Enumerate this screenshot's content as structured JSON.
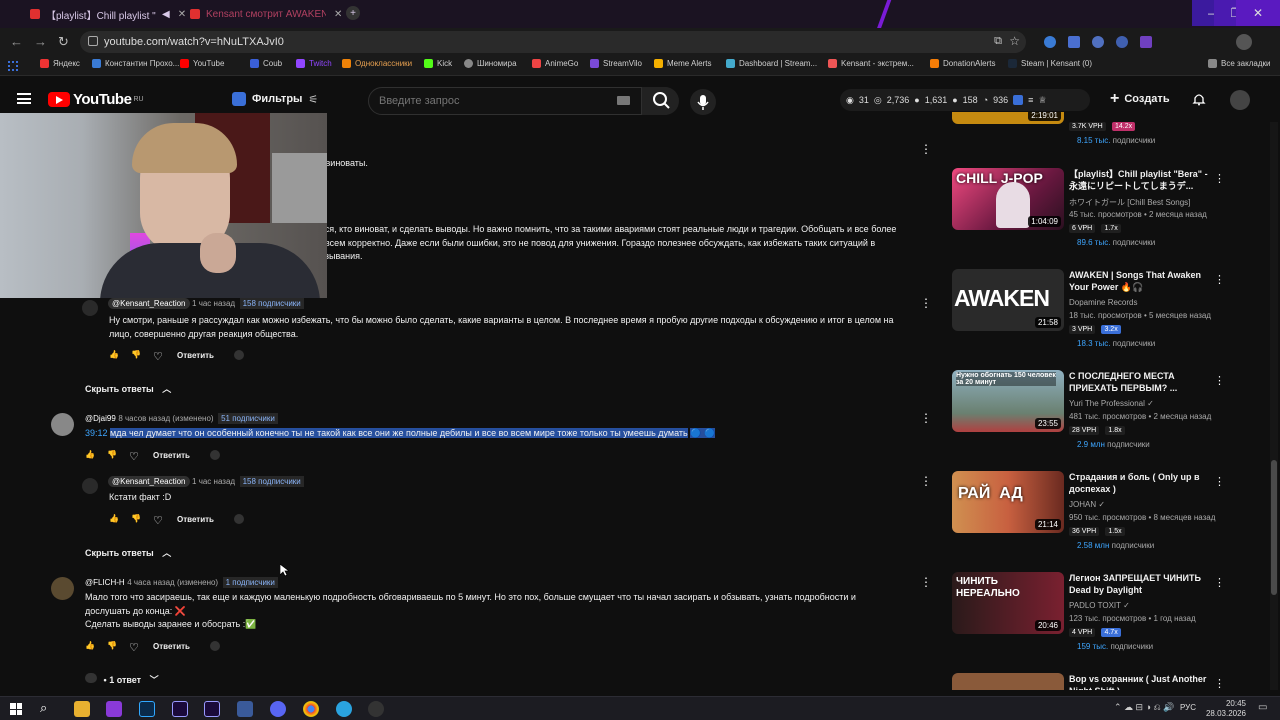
{
  "browser": {
    "tabs": [
      {
        "label": "【playlist】Chill playlist \"Bera\""
      },
      {
        "label": "Kensant смотрит AWAKEN..."
      }
    ],
    "url": "youtube.com/watch?v=hNuLTXAJvI0",
    "bookmarks": [
      "Яндекс",
      "Константин Прохо...",
      "YouTube",
      "Coub",
      "Twitch",
      "Одноклассники",
      "Kick",
      "Шиномира",
      "AnimeGo",
      "StreamVilo",
      "Meme Alerts",
      "Dashboard | Stream...",
      "Kensant - экстрем...",
      "DonationAlerts",
      "Steam | Kensant (0)",
      "Все закладки"
    ]
  },
  "youtube": {
    "logo": "YouTube",
    "region": "RU",
    "filters_label": "Фильтры",
    "search_placeholder": "Введите запрос",
    "stats": [
      "31",
      "2,736",
      "1,631",
      "158",
      "936"
    ],
    "create_label": "Создать"
  },
  "comments": {
    "top_fragment_1": "е виноваты.",
    "top_fragment_2a": "ься, кто виноват, и сделать выводы. Но важно помнить, что за такими авариями стоят реальные люди и трагедии. Обобщать и все более",
    "top_fragment_2b": "овсем корректно. Даже если были ошибки, это не повод для унижения. Гораздо полезнее обсуждать, как избежать таких ситуаций в",
    "top_fragment_2c": "азывания.",
    "reply1": {
      "author": "@Kensant_Reaction",
      "time": "1 час назад",
      "subs": "158 подписчики",
      "text_a": "Ну смотри, раньше я рассуждал как можно избежать, что бы можно было сделать, какие варианты в целом. В последнее время я пробую другие подходы к обсуждению и итог в целом на",
      "text_b": "лицо, совершенно другая реакция общества.",
      "reply_label": "Ответить"
    },
    "hide1": "Скрыть ответы",
    "c2": {
      "author": "@Djai99",
      "time": "8 часов назад (изменено)",
      "subs": "51 подписчики",
      "timestamp": "39:12",
      "text": "мда чел думает что он особенный конечно ты не такой как все они же полные дебилы и все во всем мире тоже только ты умеешь думать",
      "reply_label": "Ответить"
    },
    "reply2": {
      "author": "@Kensant_Reaction",
      "time": "1 час назад",
      "subs": "158 подписчики",
      "text": "Кстати факт :D",
      "reply_label": "Ответить"
    },
    "hide2": "Скрыть ответы",
    "c3": {
      "author": "@FLICH-H",
      "time": "4 часа назад (изменено)",
      "subs": "1 подписчики",
      "text_a": "Мало того что засираешь, так еще и каждую маленькую подробность обговариваешь по 5 минут. Но это пох, больше смущает что ты начал засирать и обзывать, узнать подробности и",
      "text_b": "дослушать до конца: ❌",
      "text_c": "Сделать выводы заранее и обосрать :✅",
      "reply_label": "Ответить",
      "one_reply": "1 ответ"
    }
  },
  "sidebar": {
    "videos": [
      {
        "title": "",
        "channel": "",
        "views": "",
        "vph": "3.7K VPH",
        "mult": "14.2x",
        "subs": "8.15 тыс.",
        "subs_label": "подписчики",
        "duration": "2:19:01",
        "color": "#c58a10"
      },
      {
        "title": "【playlist】Chill playlist \"Bera\" - 永遠にリピートしてしまうデ...",
        "channel": "ホワイトガール [Chill Best Songs]",
        "views": "45 тыс. просмотров • 2 месяца назад",
        "vph": "6 VPH",
        "mult": "1.7x",
        "subs": "89.6 тыс.",
        "subs_label": "подписчики",
        "duration": "1:04:09",
        "thumb_text": "CHILL J-POP",
        "color": "#d83a6a"
      },
      {
        "title": "AWAKEN | Songs That Awaken Your Power 🔥🎧",
        "channel": "Dopamine Records",
        "views": "18 тыс. просмотров • 5 месяцев назад",
        "vph": "3 VPH",
        "mult": "3.2x",
        "subs": "18.3 тыс.",
        "subs_label": "подписчики",
        "duration": "21:58",
        "thumb_text": "AWAKEN",
        "color": "#222"
      },
      {
        "title": "С ПОСЛЕДНЕГО МЕСТА ПРИЕХАТЬ ПЕРВЫМ? ...",
        "channel": "Yuri The Professional",
        "views": "481 тыс. просмотров • 2 месяца назад",
        "vph": "28 VPH",
        "mult": "1.8x",
        "subs": "2.9 млн",
        "subs_label": "подписчики",
        "duration": "23:55",
        "thumb_text": "Нужно обогнать 150 человек за 20 минут",
        "color": "#6a8a9a"
      },
      {
        "title": "Страдания и боль ( Only up в доспехах )",
        "channel": "JOHAN",
        "views": "950 тыс. просмотров • 8 месяцев назад",
        "vph": "36 VPH",
        "mult": "1.5x",
        "subs": "2.58 млн",
        "subs_label": "подписчики",
        "duration": "21:14",
        "thumb_text": "РАЙ  АД",
        "color": "#a07040"
      },
      {
        "title": "Легион ЗАПРЕЩАЕТ ЧИНИТЬ Dead by Daylight",
        "channel": "PADLO TOXIT",
        "views": "123 тыс. просмотров • 1 год назад",
        "vph": "4 VPH",
        "mult": "4.7x",
        "subs": "159 тыс.",
        "subs_label": "подписчики",
        "duration": "20:46",
        "thumb_text": "ЧИНИТЬ НЕРЕАЛЬНО",
        "color": "#7a2030"
      },
      {
        "title": "Bop vs охранник ( Just Another Night Shift )",
        "channel": "",
        "views": "",
        "vph": "",
        "mult": "",
        "subs": "",
        "subs_label": "",
        "duration": "",
        "color": "#8a5a3a"
      }
    ]
  },
  "taskbar": {
    "lang": "РУС",
    "time": "20:45",
    "date": "28.03.2026"
  }
}
